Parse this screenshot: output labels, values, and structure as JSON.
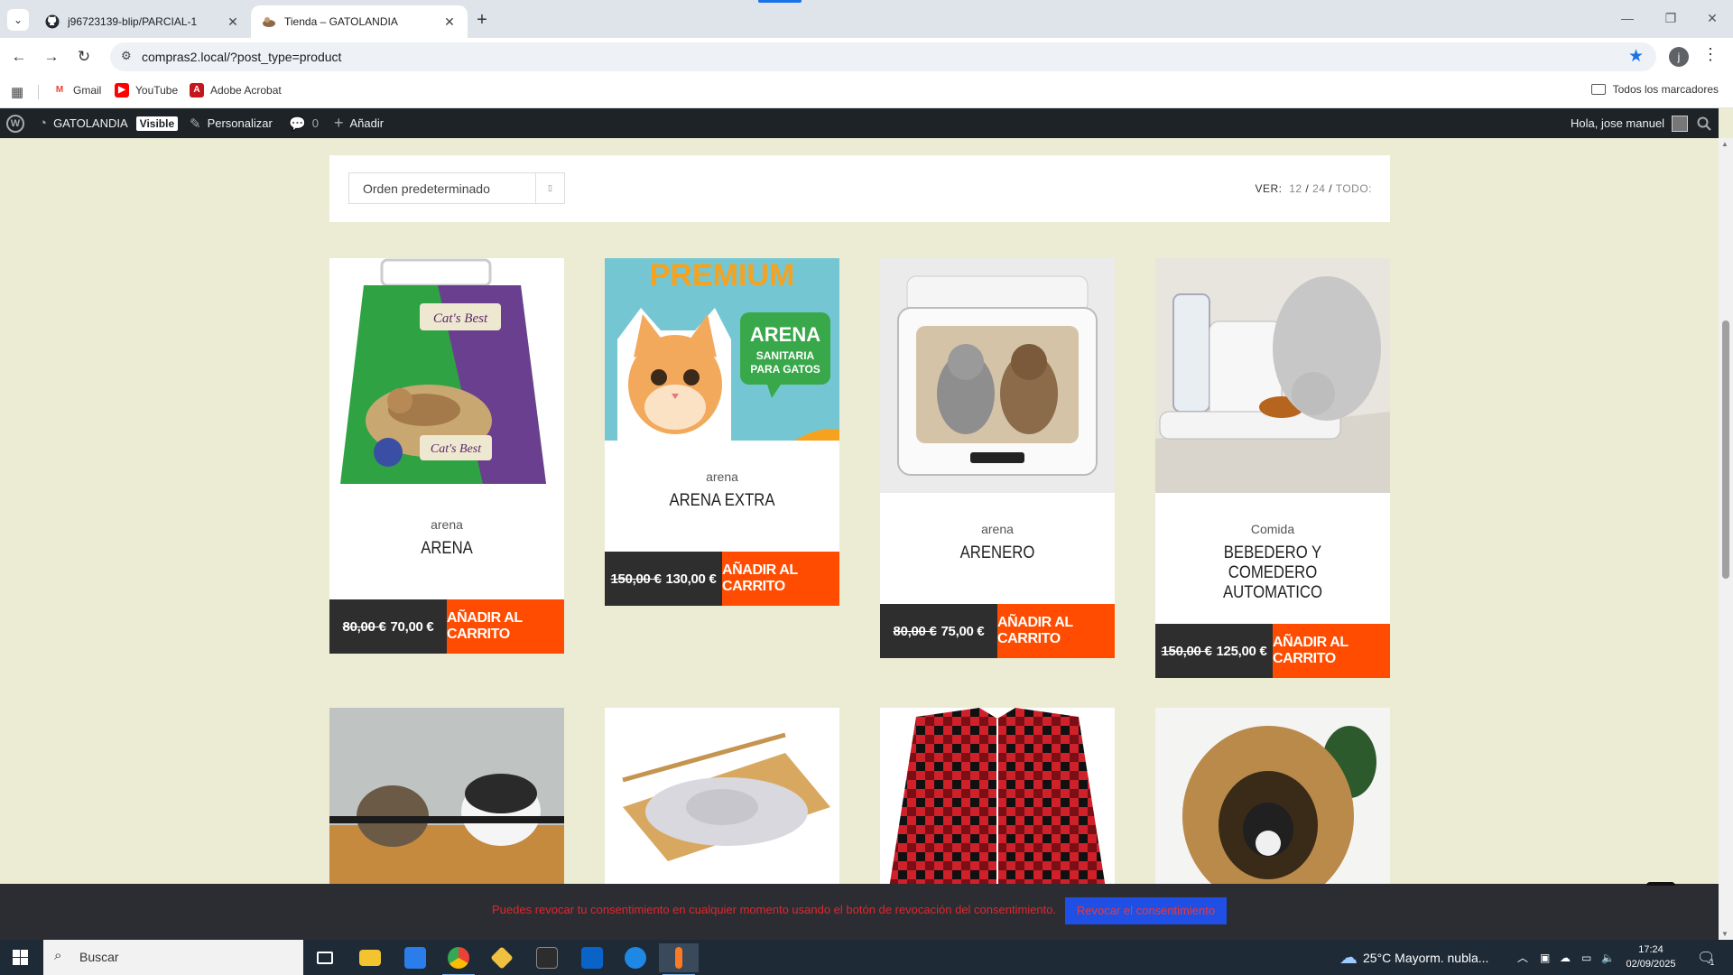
{
  "browser": {
    "tabs": [
      {
        "title": "j96723139-blip/PARCIAL-1",
        "icon": "github-icon",
        "active": false
      },
      {
        "title": "Tienda – GATOLANDIA",
        "icon": "store-favicon-icon",
        "active": true
      }
    ],
    "url": "compras2.local/?post_type=product",
    "bookmarks": [
      {
        "label": "Gmail",
        "icon": "gmail-icon",
        "color": "#ea4335"
      },
      {
        "label": "YouTube",
        "icon": "youtube-icon",
        "color": "#ff0000"
      },
      {
        "label": "Adobe Acrobat",
        "icon": "acrobat-icon",
        "color": "#c4161c"
      }
    ],
    "all_bookmarks": "Todos los marcadores"
  },
  "wpbar": {
    "site": "GATOLANDIA",
    "badge": "Visible",
    "customize": "Personalizar",
    "comments": "0",
    "add": "Añadir",
    "greeting": "Hola, jose manuel"
  },
  "shop": {
    "orderby": "Orden predeterminado",
    "perpage_label": "VER:",
    "perpage_options": [
      "12",
      "24",
      "TODO:"
    ],
    "cart_label": "AÑADIR AL CARRITO",
    "products": [
      {
        "category": "arena",
        "title": "ARENA",
        "old_price": "80,00 €",
        "price": "70,00 €"
      },
      {
        "category": "arena",
        "title": "ARENA EXTRA",
        "old_price": "150,00 €",
        "price": "130,00 €"
      },
      {
        "category": "arena",
        "title": "ARENERO",
        "old_price": "80,00 €",
        "price": "75,00 €"
      },
      {
        "category": "Comida",
        "title": "BEBEDERO Y COMEDERO AUTOMATICO",
        "old_price": "150,00 €",
        "price": "125,00 €"
      }
    ],
    "premium_text": "PREMIUM",
    "promo_badge": [
      "ARENA",
      "SANITARIA",
      "PARA GATOS"
    ]
  },
  "consent": {
    "text": "Puedes revocar tu consentimiento en cualquier momento usando el botón de revocación del consentimiento.",
    "button": "Revocar el consentimiento"
  },
  "taskbar": {
    "search_placeholder": "Buscar",
    "weather": "25°C  Mayorm. nubla...",
    "time": "17:24",
    "date": "02/09/2025",
    "notification_count": "1"
  },
  "colors": {
    "accent": "#ff4c00",
    "price_bg": "#2e2e2e",
    "page_bg": "#ececd4",
    "wpbar": "#1d2327"
  }
}
